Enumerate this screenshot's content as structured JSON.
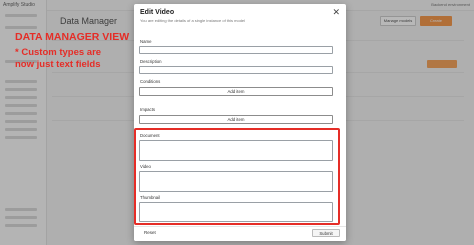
{
  "app": {
    "brand": "Amplify Studio",
    "page_title": "Data Manager",
    "top_right": "Backend environment",
    "button_left": "Manage models",
    "button_right": "Create"
  },
  "annotation": {
    "title": "DATA MANAGER VIEW",
    "subtitle": "* Custom types are\nnow just text fields"
  },
  "modal": {
    "title": "Edit Video",
    "subtitle": "You are editing the details of a single instance of this model",
    "fields": {
      "name_label": "Name",
      "description_label": "Description",
      "conditions_label": "Conditions",
      "impacts_label": "Impacts",
      "document_label": "Document",
      "video_label": "Video",
      "thumbnail_label": "Thumbnail"
    },
    "add_item_label": "Add item",
    "reset_label": "Reset",
    "submit_label": "Submit"
  },
  "colors": {
    "annotation_red": "#e52d27",
    "accent_orange": "#f59a4e"
  }
}
